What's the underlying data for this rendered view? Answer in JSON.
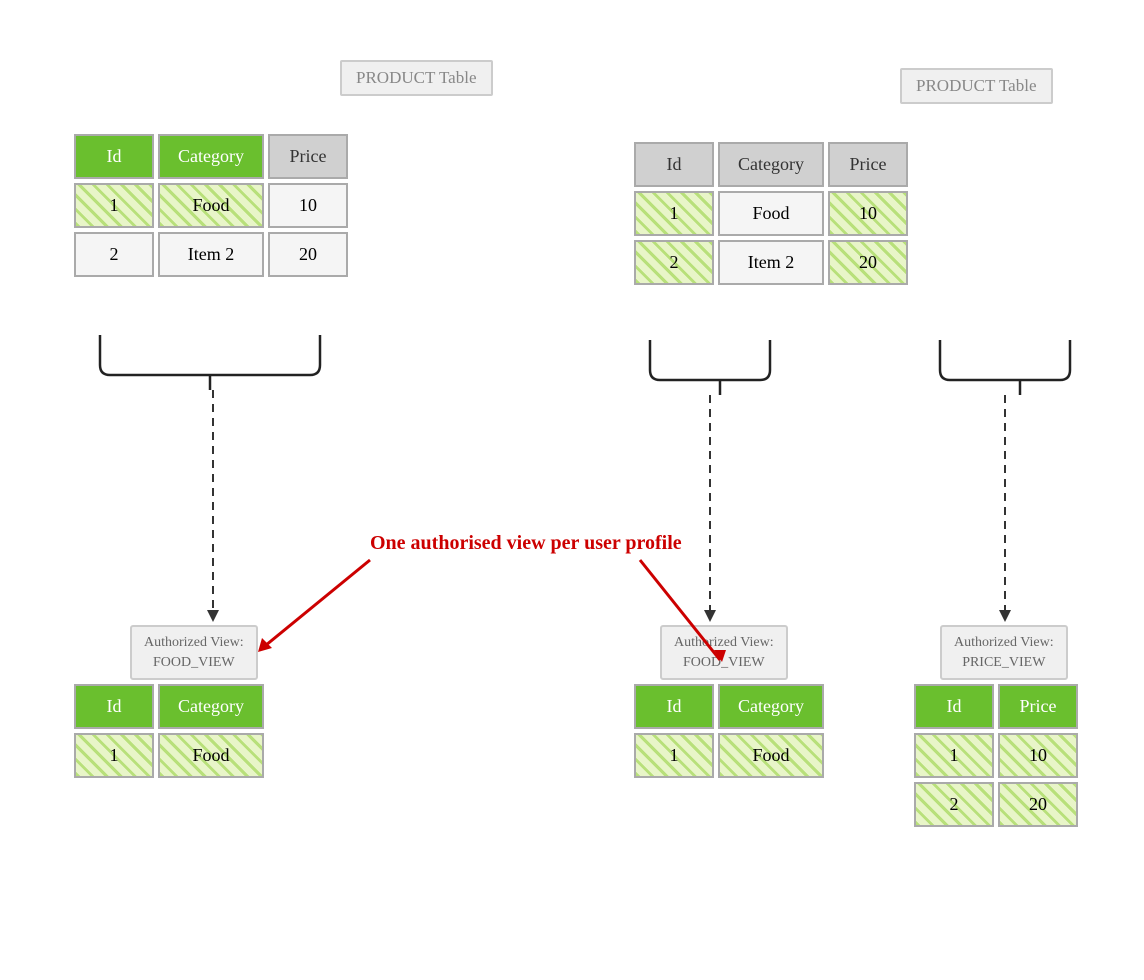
{
  "left_diagram": {
    "product_table_label": "PRODUCT Table",
    "product_table": {
      "headers": [
        "Id",
        "Category",
        "Price"
      ],
      "header_styles": [
        "green",
        "green",
        "gray"
      ],
      "rows": [
        {
          "id": "1",
          "id_style": "hatch",
          "category": "Food",
          "cat_style": "hatch",
          "price": "10",
          "price_style": "plain"
        },
        {
          "id": "2",
          "id_style": "plain",
          "category": "Item 2",
          "cat_style": "plain",
          "price": "20",
          "price_style": "plain"
        }
      ]
    },
    "view_label": "Authorized View:\nFOOD_VIEW",
    "food_view": {
      "headers": [
        "Id",
        "Category"
      ],
      "header_styles": [
        "green",
        "green"
      ],
      "rows": [
        {
          "id": "1",
          "id_style": "hatch",
          "category": "Food",
          "cat_style": "hatch"
        }
      ]
    }
  },
  "right_diagram": {
    "product_table_label": "PRODUCT Table",
    "product_table": {
      "headers": [
        "Id",
        "Category",
        "Price"
      ],
      "header_styles": [
        "gray",
        "gray",
        "gray"
      ],
      "rows": [
        {
          "id": "1",
          "id_style": "hatch",
          "category": "Food",
          "cat_style": "plain",
          "price": "10",
          "price_style": "hatch"
        },
        {
          "id": "2",
          "id_style": "hatch",
          "category": "Item 2",
          "cat_style": "plain",
          "price": "20",
          "price_style": "hatch"
        }
      ]
    },
    "food_view_label": "Authorized View:\nFOOD_VIEW",
    "food_view": {
      "headers": [
        "Id",
        "Category"
      ],
      "header_styles": [
        "green",
        "green"
      ],
      "rows": [
        {
          "id": "1",
          "id_style": "hatch",
          "category": "Food",
          "cat_style": "hatch"
        }
      ]
    },
    "price_view_label": "Authorized View:\nPRICE_VIEW",
    "price_view": {
      "headers": [
        "Id",
        "Price"
      ],
      "header_styles": [
        "green",
        "green"
      ],
      "rows": [
        {
          "id": "1",
          "id_style": "hatch",
          "price": "10",
          "price_style": "hatch"
        },
        {
          "id": "2",
          "id_style": "hatch",
          "price": "20",
          "price_style": "hatch"
        }
      ]
    }
  },
  "annotation": "One authorised view per user profile"
}
